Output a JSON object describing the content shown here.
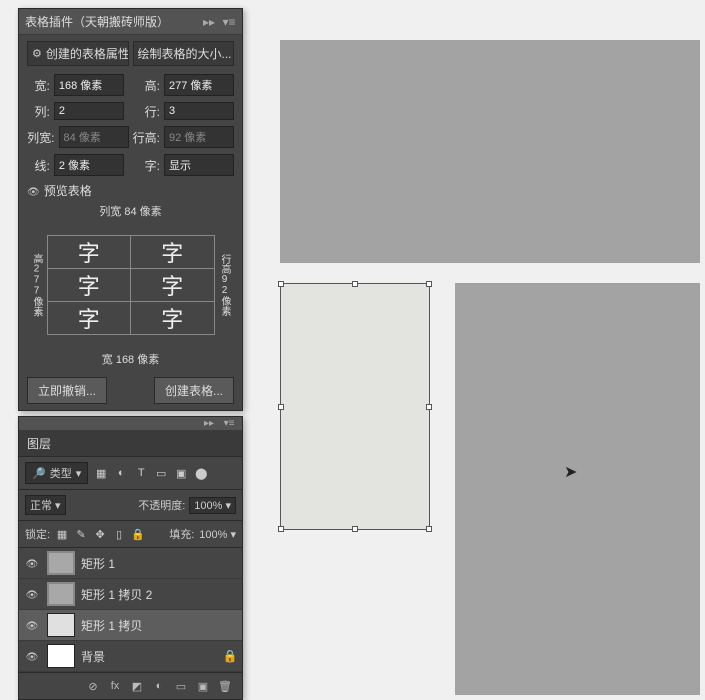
{
  "tablePanel": {
    "title": "表格插件（天朝搬砖师版）",
    "tabs": {
      "attrs": "创建的表格属性",
      "size": "绘制表格的大小..."
    },
    "fields": {
      "width": {
        "label": "宽:",
        "value": "168 像素"
      },
      "height": {
        "label": "高:",
        "value": "277 像素"
      },
      "cols": {
        "label": "列:",
        "value": "2"
      },
      "rows": {
        "label": "行:",
        "value": "3"
      },
      "colW": {
        "label": "列宽:",
        "value": "84 像素"
      },
      "rowH": {
        "label": "行高:",
        "value": "92 像素"
      },
      "line": {
        "label": "线:",
        "value": "2 像素"
      },
      "font": {
        "label": "字:",
        "value": "显示"
      }
    },
    "previewHeader": "预览表格",
    "previewCell": "字",
    "colWidthLabel": "列宽 84 像素",
    "rowHeightLabel": "行高92像素",
    "totalHeightLabel": "高277像素",
    "totalWidthLabel": "宽 168 像素",
    "undoBtn": "立即撤销...",
    "createBtn": "创建表格..."
  },
  "layersPanel": {
    "title": "图层",
    "filterLabel": "类型",
    "mode": "正常",
    "opacityLabel": "不透明度:",
    "opacityVal": "100%",
    "lockLabel": "锁定:",
    "fillLabel": "填充:",
    "fillVal": "100%",
    "layers": [
      {
        "name": "矩形 1",
        "sel": false
      },
      {
        "name": "矩形 1 拷贝 2",
        "sel": false
      },
      {
        "name": "矩形 1 拷贝",
        "sel": true
      },
      {
        "name": "背景",
        "sel": false,
        "locked": true
      }
    ]
  }
}
